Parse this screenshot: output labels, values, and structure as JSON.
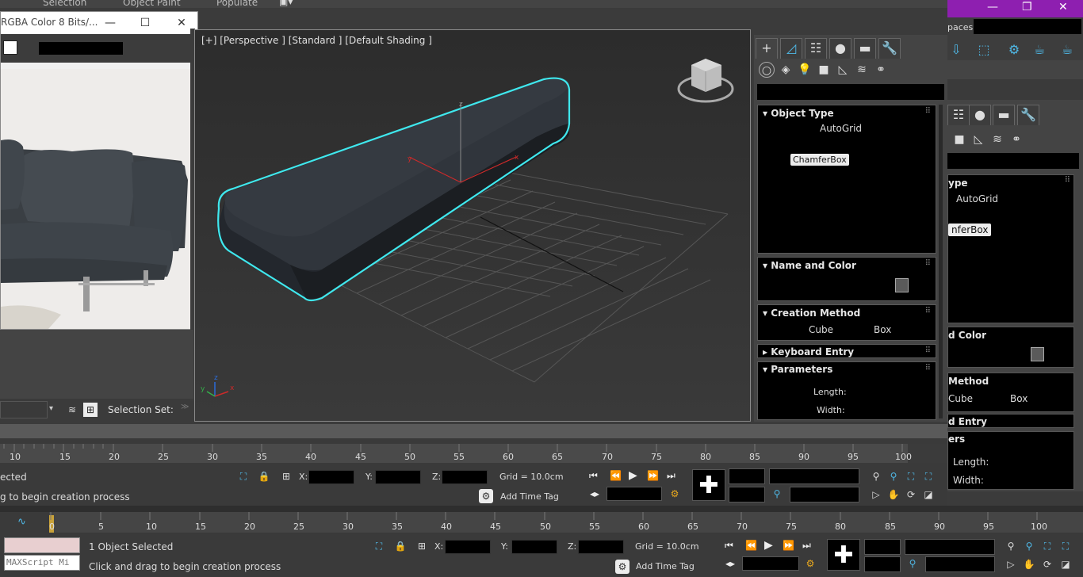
{
  "menubar": {
    "items": [
      "Selection",
      "Object Paint",
      "Populate"
    ]
  },
  "behind_window": {
    "workspaces_label": "paces:",
    "rollouts": {
      "object_type": "ype",
      "autogrid": "AutoGrid",
      "chamferbox": "nferBox",
      "name_color": "d Color",
      "creation_method": "Method",
      "cube": "Cube",
      "box": "Box",
      "keyboard_entry": "d Entry",
      "parameters": "ers",
      "length": "Length:",
      "width": "Width:"
    }
  },
  "image_window": {
    "title": "RGBA Color 8 Bits/..."
  },
  "left_panel": {
    "selection_set_label": "Selection Set:"
  },
  "viewport": {
    "label": "[+] [Perspective ] [Standard ] [Default Shading ]",
    "axis_x": "x",
    "axis_y": "y",
    "axis_z": "z"
  },
  "command_panel": {
    "rollouts": {
      "object_type": "Object Type",
      "autogrid": "AutoGrid",
      "chamferbox": "ChamferBox",
      "name_color": "Name and Color",
      "creation_method": "Creation Method",
      "cube": "Cube",
      "box": "Box",
      "keyboard_entry": "Keyboard Entry",
      "parameters": "Parameters",
      "length": "Length:",
      "width": "Width:"
    }
  },
  "timeline_upper": {
    "ticks": [
      "10",
      "15",
      "20",
      "25",
      "30",
      "35",
      "40",
      "45",
      "50",
      "55",
      "60",
      "65",
      "70",
      "75",
      "80",
      "85",
      "90",
      "95",
      "100"
    ]
  },
  "status_upper": {
    "selected": "ected",
    "prompt": "g to begin creation process",
    "x_label": "X:",
    "y_label": "Y:",
    "z_label": "Z:",
    "grid": "Grid = 10.0cm",
    "add_time_tag": "Add Time Tag"
  },
  "timeline_lower": {
    "ticks": [
      "0",
      "5",
      "10",
      "15",
      "20",
      "25",
      "30",
      "35",
      "40",
      "45",
      "50",
      "55",
      "60",
      "65",
      "70",
      "75",
      "80",
      "85",
      "90",
      "95",
      "100"
    ]
  },
  "status_lower": {
    "maxscript": "MAXScript Mi",
    "selected": "1 Object Selected",
    "prompt": "Click and drag to begin creation process",
    "x_label": "X:",
    "y_label": "Y:",
    "z_label": "Z:",
    "grid": "Grid = 10.0cm",
    "add_time_tag": "Add Time Tag"
  },
  "colors": {
    "selection_outline": "#3fe8ee",
    "title_purple": "#8e1fb0",
    "accent_blue": "#4fb8e6"
  }
}
